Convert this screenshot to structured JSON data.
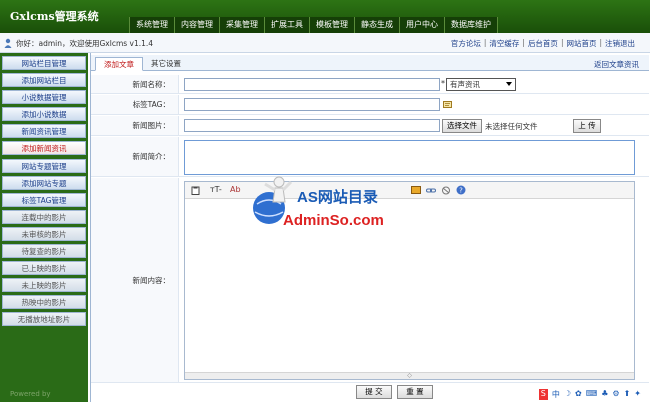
{
  "app": {
    "title": "Gxlcms管理系统"
  },
  "topnav": [
    "系统管理",
    "内容管理",
    "采集管理",
    "扩展工具",
    "模板管理",
    "静态生成",
    "用户中心",
    "数据库维护"
  ],
  "infobar": {
    "welcome": "你好：admin，欢迎使用Gxlcms v1.1.4",
    "links": [
      "官方论坛",
      "清空缓存",
      "后台首页",
      "网站首页",
      "注销退出"
    ]
  },
  "sidebar": {
    "items": [
      "网站栏目管理",
      "添加网站栏目",
      "小说数据管理",
      "添加小说数据",
      "新闻资讯管理",
      "添加新闻资讯",
      "网站专题管理",
      "添加网站专题",
      "标签TAG管理",
      "连载中的影片",
      "未审核的影片",
      "待复查的影片",
      "已上映的影片",
      "未上映的影片",
      "热映中的影片",
      "无播放地址影片"
    ],
    "active_index": 5,
    "powered": "Powered by"
  },
  "tabs": {
    "active": "添加文章",
    "other": "其它设置",
    "back": "返回文章资讯"
  },
  "form": {
    "title_label": "新闻名称：",
    "required_mark": "*",
    "category_selected": "有声资讯",
    "tag_label": "标签TAG：",
    "image_label": "新闻图片：",
    "choose_file": "选择文件",
    "no_file": "未选择任何文件",
    "upload": "上 传",
    "summary_label": "新闻简介：",
    "content_label": "新闻内容："
  },
  "editor": {
    "font_size": "тT-",
    "font_style": "Ab",
    "resize": "◇"
  },
  "watermark": {
    "title": "AS网站目录",
    "site": "AdminSo.com"
  },
  "actions": {
    "submit": "提 交",
    "reset": "重 置"
  },
  "ime": [
    "S",
    "中",
    "☽",
    "✿",
    "⌨",
    "♣",
    "⚙",
    "⬆",
    "✦"
  ],
  "colors": {
    "header_green": "#1f5a0c",
    "active_red": "#c01818",
    "link_blue": "#1d3f8a"
  }
}
